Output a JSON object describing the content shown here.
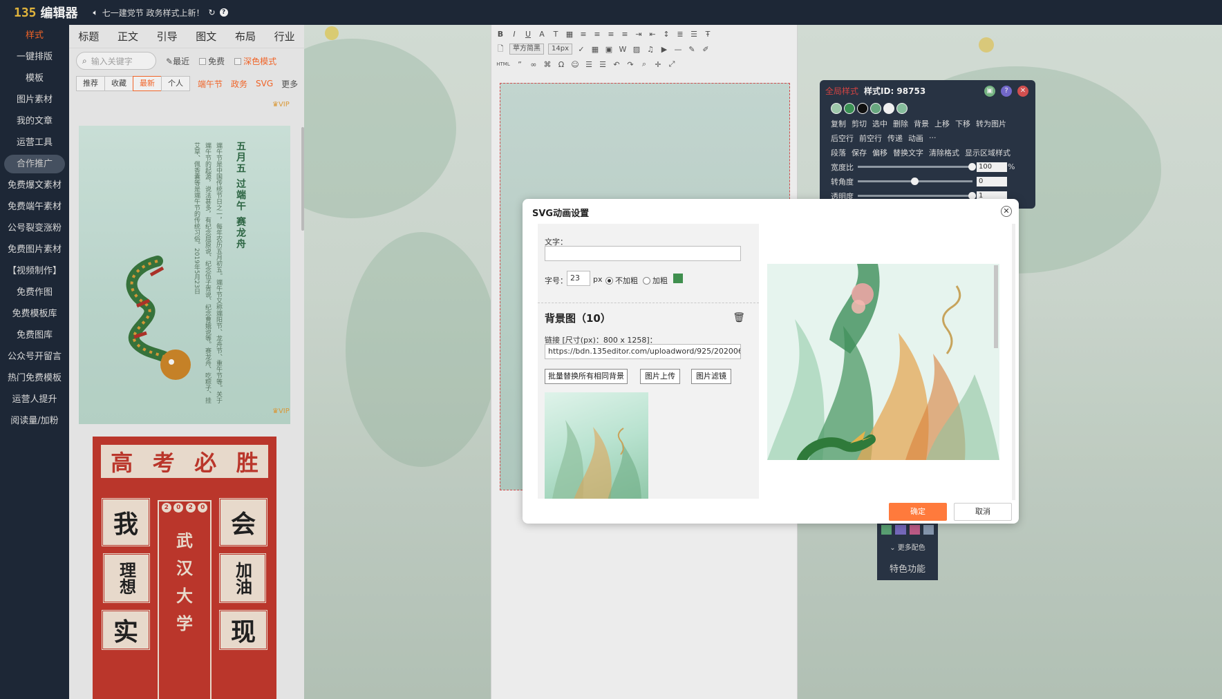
{
  "topbar": {
    "logo_mark": "135",
    "logo_text": "编辑器",
    "notice": "七一建党节 政务样式上新！"
  },
  "leftnav": {
    "items": [
      {
        "label": "样式",
        "active": true
      },
      {
        "label": "一键排版"
      },
      {
        "label": "模板"
      },
      {
        "label": "图片素材"
      },
      {
        "label": "我的文章"
      },
      {
        "label": "运营工具"
      },
      {
        "label": "合作推广",
        "pill": true
      },
      {
        "label": "免费爆文素材"
      },
      {
        "label": "免费端午素材"
      },
      {
        "label": "公号裂变涨粉"
      },
      {
        "label": "免费图片素材"
      },
      {
        "label": "【视频制作】"
      },
      {
        "label": "免费作图"
      },
      {
        "label": "免费模板库"
      },
      {
        "label": "免费图库"
      },
      {
        "label": "公众号开留言"
      },
      {
        "label": "热门免费模板"
      },
      {
        "label": "运营人提升"
      },
      {
        "label": "阅读量/加粉"
      }
    ]
  },
  "stylepanel": {
    "categories": [
      "标题",
      "正文",
      "引导",
      "图文",
      "布局",
      "行业"
    ],
    "search_placeholder": "输入关键字",
    "recent": "最近",
    "free": "免费",
    "dark_mode": "深色模式",
    "tags": [
      "推荐",
      "收藏",
      "最新",
      "个人"
    ],
    "active_tag": "最新",
    "links": [
      "端午节",
      "政务",
      "SVG"
    ],
    "more": "更多",
    "vip": "VIP",
    "card1": {
      "title": "五月五 过端午 赛龙舟",
      "body": "端午节是中国传统节日之一，每年农历五月初五。端午节又称端阳节、龙舟节、重午节等。关于端午节的起源，说法甚多，有纪念屈原说、纪念伍子胥说、纪念曹娥说等。赛龙舟、吃粽子、挂艾草、佩香囊等是端午节的传统习俗。2019年5月23日"
    },
    "card2": {
      "band": [
        "高",
        "考",
        "必",
        "胜"
      ],
      "year": [
        "2",
        "0",
        "2",
        "0"
      ],
      "left_top": "我",
      "left_mid": "理想",
      "left_bot": "实",
      "right_top": "会",
      "right_mid": "加油",
      "right_bot": "现",
      "school": [
        "武",
        "汉",
        "大",
        "学"
      ]
    }
  },
  "editor": {
    "font": "苹方简黑",
    "size": "14px",
    "html_label": "HTML"
  },
  "toolpanel": {
    "title_red": "全局样式",
    "style_id": "样式ID: 98753",
    "swatch_colors": [
      "#a8d5b5",
      "#3f9a5a",
      "#111111",
      "#6fb287",
      "#ffffff",
      "#8fc9a6"
    ],
    "row1": [
      "复制",
      "剪切",
      "选中",
      "删除",
      "背景",
      "上移",
      "下移",
      "转为图片"
    ],
    "row2": [
      "后空行",
      "前空行",
      "传递",
      "动画",
      "···"
    ],
    "row3": [
      "段落",
      "保存",
      "偏移",
      "替换文字",
      "清除格式",
      "显示区域样式"
    ],
    "width_label": "宽度比",
    "width_value": "100",
    "width_unit": "%",
    "rotate_label": "转角度",
    "rotate_value": "0",
    "opacity_label": "透明度",
    "opacity_value": "1",
    "width_level": 1.0,
    "rotate_level": 0.5,
    "opacity_level": 1.0
  },
  "bottomtool": {
    "swatches": [
      "#5fa97a",
      "#7d6fc6",
      "#c8608e",
      "#8ea0b8"
    ],
    "more_colors": "更多配色",
    "feature": "特色功能"
  },
  "modal": {
    "title": "SVG动画设置",
    "text_label": "文字：",
    "text_value": "",
    "fontsize_label": "字号：",
    "fontsize_value": "23",
    "px": "px",
    "not_bold": "不加粗",
    "bold": "加粗",
    "text_color": "#3f8f4e",
    "bg_section": "背景图（10）",
    "link_label": "链接 [尺寸(px)：800 x 1258]：",
    "link_value": "https://bdn.135editor.com/uploadword/925/202006/5",
    "btn_replace_all": "批量替换所有相同背景",
    "btn_upload": "图片上传",
    "btn_filter": "图片滤镜",
    "ok": "确定",
    "cancel": "取消"
  }
}
